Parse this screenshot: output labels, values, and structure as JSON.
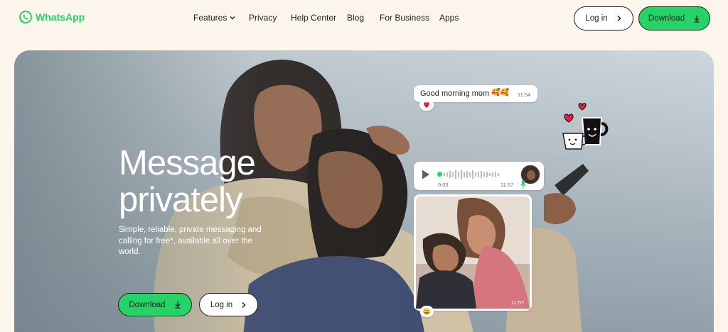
{
  "brand": {
    "name": "WhatsApp",
    "color": "#25d366"
  },
  "nav": {
    "links": [
      {
        "label": "Features",
        "has_dropdown": true
      },
      {
        "label": "Privacy"
      },
      {
        "label": "Help Center"
      },
      {
        "label": "Blog"
      },
      {
        "label": "For Business"
      },
      {
        "label": "Apps"
      }
    ],
    "login_label": "Log in",
    "download_label": "Download"
  },
  "hero": {
    "title_line1": "Message",
    "title_line2": "privately",
    "subtitle": "Simple, reliable, private messaging and calling for free*, available all over the world.",
    "download_label": "Download",
    "login_label": "Log in"
  },
  "chat": {
    "message_text": "Good morning mom",
    "message_time": "11:54",
    "message_reaction": "heart",
    "voice_duration": "0:03",
    "voice_time": "11:57",
    "photo_time": "11:57",
    "photo_reaction": "smile-emoji"
  },
  "colors": {
    "accent": "#25d366",
    "background": "#fcf5eb",
    "text": "#1c1e21"
  }
}
